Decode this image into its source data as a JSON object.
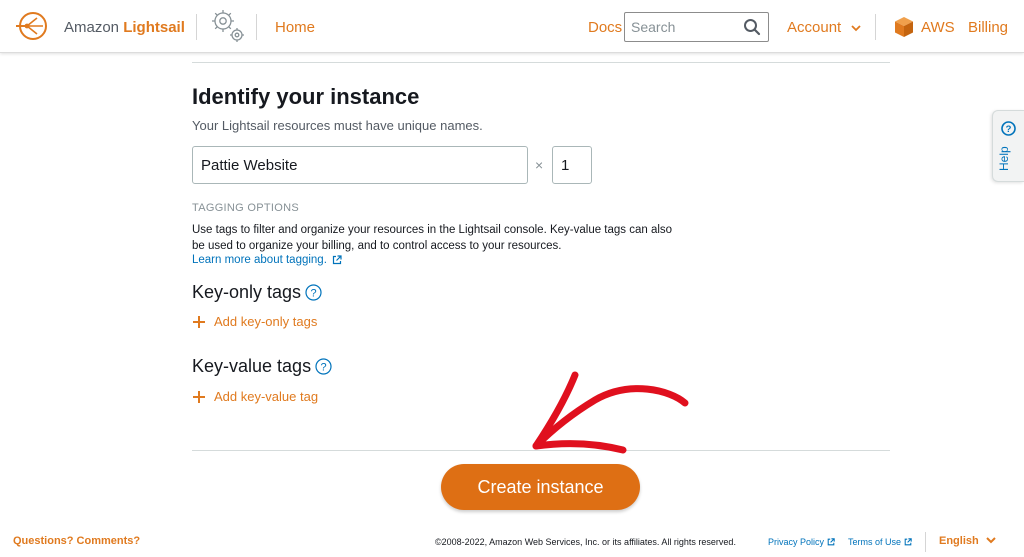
{
  "header": {
    "brand_prefix": "Amazon",
    "brand_name": "Lightsail",
    "home": "Home",
    "docs": "Docs",
    "search_placeholder": "Search",
    "account": "Account",
    "aws": "AWS",
    "billing": "Billing"
  },
  "identify": {
    "title": "Identify your instance",
    "subtitle": "Your Lightsail resources must have unique names.",
    "name_value": "Pattie Website",
    "multiplier": "×",
    "count_value": "1"
  },
  "tagging": {
    "heading": "TAGGING OPTIONS",
    "description": "Use tags to filter and organize your resources in the Lightsail console. Key-value tags can also be used to organize your billing, and to control access to your resources.",
    "learn_more": "Learn more about tagging.",
    "key_only_title": "Key-only tags",
    "add_key_only": "Add key-only tags",
    "key_value_title": "Key-value tags",
    "add_key_value": "Add key-value tag"
  },
  "help": {
    "label": "Help"
  },
  "actions": {
    "create": "Create instance"
  },
  "footer": {
    "questions": "Questions? Comments?",
    "copyright": "©2008-2022, Amazon Web Services, Inc. or its affiliates. All rights reserved.",
    "privacy": "Privacy Policy",
    "terms": "Terms of Use",
    "language": "English"
  },
  "colors": {
    "accent": "#e07a1f",
    "button": "#de6f14",
    "link": "#0073bb",
    "annotation": "#e0101e"
  },
  "icons": {
    "logo": "lightsail-logo-icon",
    "gears": "gears-icon",
    "search": "search-icon",
    "aws": "aws-cube-icon",
    "external": "external-link-icon",
    "question": "question-icon",
    "plus": "plus-icon"
  }
}
